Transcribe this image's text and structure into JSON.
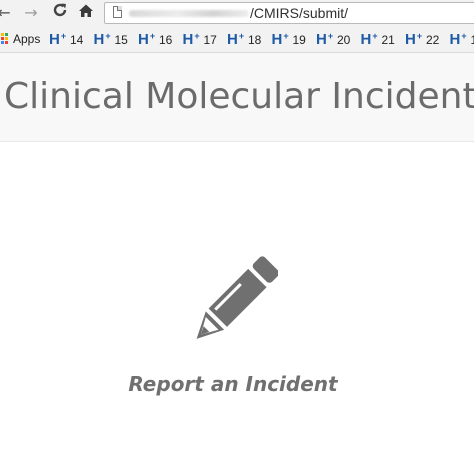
{
  "browser": {
    "nav": {
      "back_glyph": "←",
      "forward_glyph": "→",
      "reload_glyph": "C",
      "home_glyph": "⌂"
    },
    "address_bar": {
      "url_visible": "/CMIRS/submit/"
    },
    "bookmarks": {
      "apps_label": "Apps",
      "apps_colors": [
        "#e94235",
        "#fbbc05",
        "#34a853",
        "#4285f4",
        "#ea4335",
        "#fbbc05",
        "#34a853",
        "#4285f4",
        "#ea4335"
      ],
      "icon_letter": "H",
      "icon_sup": "+",
      "icon_color": "#1f5aa6",
      "items": [
        {
          "label": "14"
        },
        {
          "label": "15"
        },
        {
          "label": "16"
        },
        {
          "label": "17"
        },
        {
          "label": "18"
        },
        {
          "label": "19"
        },
        {
          "label": "20"
        },
        {
          "label": "21"
        },
        {
          "label": "22"
        },
        {
          "label": "1"
        }
      ]
    }
  },
  "header": {
    "title": "Clinical Molecular Incident"
  },
  "main": {
    "report_link": {
      "icon": "pencil-icon",
      "label": "Report an Incident",
      "color": "#707070"
    }
  }
}
